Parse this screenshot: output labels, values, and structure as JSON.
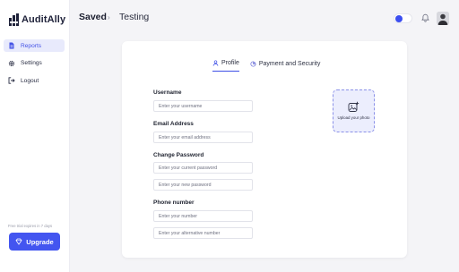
{
  "app": {
    "name": "AuditAlly"
  },
  "sidebar": {
    "items": [
      {
        "label": "Reports",
        "icon": "document-icon",
        "active": true
      },
      {
        "label": "Settings",
        "icon": "gear-icon",
        "active": false
      },
      {
        "label": "Logout",
        "icon": "logout-icon",
        "active": false
      }
    ],
    "trial_text": "Free trial expires in 7 days",
    "upgrade_label": "Upgrade"
  },
  "header": {
    "breadcrumb_root": "Saved",
    "breadcrumb_separator": "›",
    "breadcrumb_current": "Testing",
    "theme_toggle_on": true
  },
  "profile": {
    "tabs": [
      {
        "label": "Profile",
        "active": true
      },
      {
        "label": "Payment and Security",
        "active": false
      }
    ],
    "username_label": "Username",
    "username_placeholder": "Enter your username",
    "email_label": "Email Address",
    "email_placeholder": "Enter your email address",
    "password_label": "Change Password",
    "current_password_placeholder": "Enter your current password",
    "new_password_placeholder": "Enter your new password",
    "phone_label": "Phone number",
    "phone_placeholder": "Enter your number",
    "alt_phone_placeholder": "Enter your alternative number",
    "upload_text": "Upload your photo"
  },
  "colors": {
    "accent": "#4355f0",
    "active_nav_bg": "#e8eafc",
    "page_bg": "#f4f4f7"
  }
}
